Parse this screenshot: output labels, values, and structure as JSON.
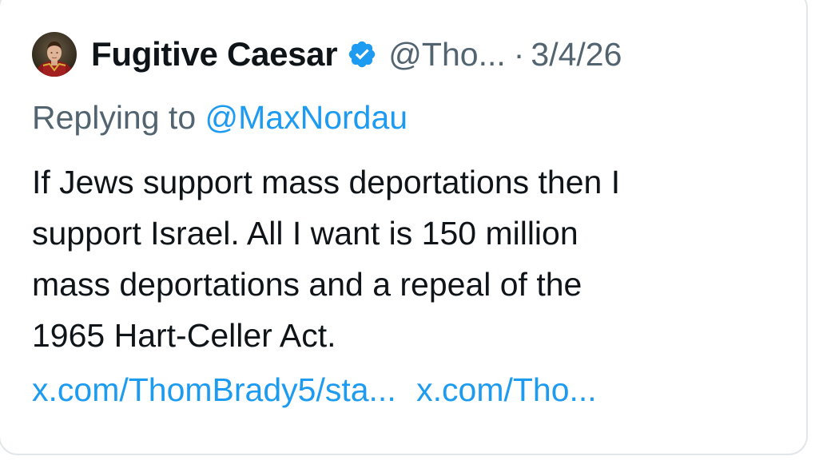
{
  "tweet": {
    "display_name": "Fugitive Caesar",
    "handle": "@Tho...",
    "separator": "·",
    "date": "3/4/26",
    "reply_prefix": "Replying to",
    "reply_handle": "@MaxNordau",
    "body_lines": [
      "If Jews support mass deportations then I",
      "support Israel. All I want is 150 million",
      "mass deportations and a repeal of the",
      "1965 Hart-Celler Act."
    ],
    "links": [
      "x.com/ThomBrady5/sta...",
      "x.com/Tho..."
    ]
  },
  "colors": {
    "text_primary": "#0f1419",
    "text_secondary": "#536471",
    "accent_blue": "#1d9bf0",
    "card_border": "#e3e6e9"
  },
  "icons": {
    "avatar": "avatar-portrait",
    "verified": "verified-badge-icon"
  }
}
